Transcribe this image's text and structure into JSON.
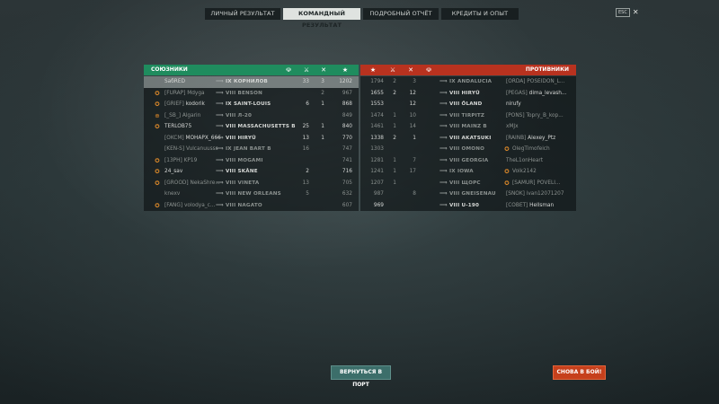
{
  "tabs": [
    "ЛИЧНЫЙ РЕЗУЛЬТАТ",
    "КОМАНДНЫЙ РЕЗУЛЬТАТ",
    "ПОДРОБНЫЙ ОТЧЁТ",
    "КРЕДИТЫ И ОПЫТ"
  ],
  "active_tab": 1,
  "esc_label": "ESC",
  "close_glyph": "✕",
  "allies_title": "СОЮЗНИКИ",
  "enemies_title": "ПРОТИВНИКИ",
  "allies": [
    {
      "clan": "",
      "name": "SaбRED",
      "icon": "",
      "tier": "IX",
      "ship": "КОРНИЛОВ",
      "c1": "33",
      "c2": "3",
      "score": "1202",
      "me": true,
      "dead": false
    },
    {
      "clan": "[FURAP]",
      "name": "Mdyga",
      "icon": "✪",
      "tier": "VIII",
      "ship": "BENSON",
      "c1": "",
      "c2": "2",
      "score": "967",
      "me": false,
      "dead": true
    },
    {
      "clan": "[GRIEF]",
      "name": "kodorik",
      "icon": "✪",
      "tier": "IX",
      "ship": "SAINT-LOUIS",
      "c1": "6",
      "c2": "1",
      "score": "868",
      "me": false,
      "dead": false
    },
    {
      "clan": "[_SB_]",
      "name": "Algarin",
      "icon": "⊕",
      "tier": "VIII",
      "ship": "Л-20",
      "c1": "",
      "c2": "",
      "score": "849",
      "me": false,
      "dead": true
    },
    {
      "clan": "",
      "name": "TERLOB75",
      "icon": "✪",
      "tier": "VIII",
      "ship": "MASSACHUSETTS B",
      "c1": "25",
      "c2": "1",
      "score": "840",
      "me": false,
      "dead": false
    },
    {
      "clan": "[OKCM]",
      "name": "MOHAPX_666",
      "icon": "",
      "tier": "VIII",
      "ship": "HIRYŪ",
      "c1": "13",
      "c2": "1",
      "score": "770",
      "me": false,
      "dead": false
    },
    {
      "clan": "[KEN-S]",
      "name": "Vulcanuusss",
      "icon": "",
      "tier": "IX",
      "ship": "JEAN BART B",
      "c1": "16",
      "c2": "",
      "score": "747",
      "me": false,
      "dead": true
    },
    {
      "clan": "[13PH]",
      "name": "KP19",
      "icon": "✪",
      "tier": "VIII",
      "ship": "MOGAMI",
      "c1": "",
      "c2": "",
      "score": "741",
      "me": false,
      "dead": true
    },
    {
      "clan": "",
      "name": "24_sav",
      "icon": "✪",
      "tier": "VIII",
      "ship": "SKÅNE",
      "c1": "2",
      "c2": "",
      "score": "716",
      "me": false,
      "dead": false
    },
    {
      "clan": "[GROOD]",
      "name": "NekaShre...",
      "icon": "✪",
      "tier": "VIII",
      "ship": "VINETA",
      "c1": "13",
      "c2": "",
      "score": "705",
      "me": false,
      "dead": true
    },
    {
      "clan": "",
      "name": "knexv",
      "icon": "",
      "tier": "VIII",
      "ship": "NEW ORLEANS",
      "c1": "5",
      "c2": "",
      "score": "632",
      "me": false,
      "dead": true
    },
    {
      "clan": "[FANG]",
      "name": "volodya_c...",
      "icon": "✪",
      "tier": "VIII",
      "ship": "NAGATO",
      "c1": "",
      "c2": "",
      "score": "607",
      "me": false,
      "dead": true
    }
  ],
  "enemies": [
    {
      "score": "1794",
      "c1": "2",
      "c2": "3",
      "tier": "IX",
      "ship": "ANDALUCIA",
      "clan": "[ORDA]",
      "name": "POSEIDON_L...",
      "icon": "",
      "dead": true
    },
    {
      "score": "1655",
      "c1": "2",
      "c2": "12",
      "tier": "VIII",
      "ship": "HIRYŪ",
      "clan": "[PEGAS]",
      "name": "dima_levash...",
      "icon": "",
      "dead": false
    },
    {
      "score": "1553",
      "c1": "",
      "c2": "12",
      "tier": "VIII",
      "ship": "ÖLAND",
      "clan": "",
      "name": "nirufy",
      "icon": "",
      "dead": false
    },
    {
      "score": "1474",
      "c1": "1",
      "c2": "10",
      "tier": "VIII",
      "ship": "TIRPITZ",
      "clan": "[PONS]",
      "name": "Topry_B_kop...",
      "icon": "",
      "dead": true
    },
    {
      "score": "1461",
      "c1": "1",
      "c2": "14",
      "tier": "VIII",
      "ship": "MAINZ B",
      "clan": "",
      "name": "xMJx",
      "icon": "",
      "dead": true
    },
    {
      "score": "1338",
      "c1": "2",
      "c2": "1",
      "tier": "VIII",
      "ship": "AKATSUKI",
      "clan": "[RAINB]",
      "name": "Alexey_Ptz",
      "icon": "",
      "dead": false
    },
    {
      "score": "1303",
      "c1": "",
      "c2": "",
      "tier": "VIII",
      "ship": "OMONO",
      "clan": "",
      "name": "OlegTimofeich",
      "icon": "✪",
      "dead": true
    },
    {
      "score": "1281",
      "c1": "1",
      "c2": "7",
      "tier": "VIII",
      "ship": "GEORGIA",
      "clan": "",
      "name": "TheL1onHeart",
      "icon": "",
      "dead": true
    },
    {
      "score": "1241",
      "c1": "1",
      "c2": "17",
      "tier": "IX",
      "ship": "IOWA",
      "clan": "",
      "name": "Volk2142",
      "icon": "✪",
      "dead": true
    },
    {
      "score": "1207",
      "c1": "1",
      "c2": "",
      "tier": "VIII",
      "ship": "ЩОРС",
      "clan": "[SAMUR]",
      "name": "POVELI...",
      "icon": "✪",
      "dead": true
    },
    {
      "score": "987",
      "c1": "",
      "c2": "8",
      "tier": "VIII",
      "ship": "GNEISENAU",
      "clan": "[SNOK]",
      "name": "ivan12071207",
      "icon": "",
      "dead": true
    },
    {
      "score": "969",
      "c1": "",
      "c2": "",
      "tier": "VIII",
      "ship": "U-190",
      "clan": "[СОВЕТ]",
      "name": "Hellsman",
      "icon": "",
      "dead": false
    }
  ],
  "buttons": {
    "port": "ВЕРНУТЬСЯ В ПОРТ",
    "battle": "СНОВА В БОЙ!"
  }
}
